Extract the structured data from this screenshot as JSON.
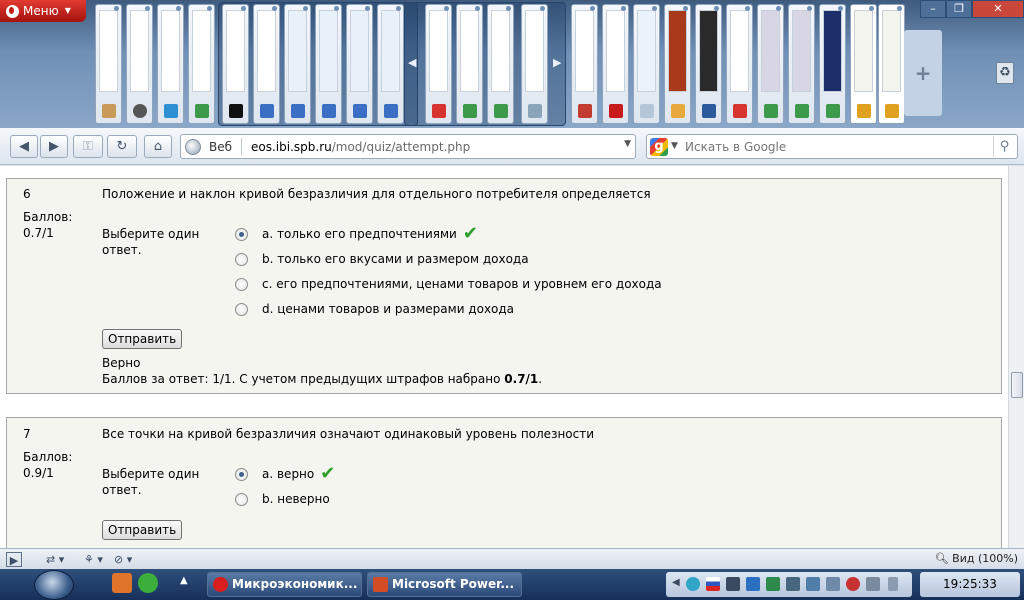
{
  "browser": {
    "menu_label": "Меню",
    "address": {
      "web_label": "Веб",
      "url_domain": "eos.ibi.spb.ru",
      "url_path": "/mod/quiz/attempt.php"
    },
    "search": {
      "placeholder": "Искать в Google"
    }
  },
  "quiz": {
    "questions": [
      {
        "number": "6",
        "text": "Положение и наклон кривой безразличия для отдельного потребителя определяется",
        "grade_label": "Баллов:",
        "grade_value": "0.7/1",
        "prompt": "Выберите один ответ.",
        "options": [
          {
            "label": "a. только его предпочтениями",
            "selected": true,
            "correct": true
          },
          {
            "label": "b. только его вкусами и размером дохода",
            "selected": false,
            "correct": false
          },
          {
            "label": "c. его предпочтениями, ценами товаров и уровнем его дохода",
            "selected": false,
            "correct": false
          },
          {
            "label": "d. ценами товаров и размерами дохода",
            "selected": false,
            "correct": false
          }
        ],
        "submit_label": "Отправить",
        "feedback_status": "Верно",
        "feedback_text": "Баллов за ответ: 1/1. С учетом предыдущих штрафов набрано ",
        "feedback_score": "0.7/1",
        "feedback_end": "."
      },
      {
        "number": "7",
        "text": "Все точки на кривой безразличия означают одинаковый уровень полезности",
        "grade_label": "Баллов:",
        "grade_value": "0.9/1",
        "prompt": "Выберите один ответ.",
        "options": [
          {
            "label": "a. верно",
            "selected": true,
            "correct": true
          },
          {
            "label": "b. неверно",
            "selected": false,
            "correct": false
          }
        ],
        "submit_label": "Отправить"
      }
    ]
  },
  "statusbar": {
    "zoom_label": "Вид (100%)"
  },
  "taskbar": {
    "tasks": [
      {
        "label": "Микроэкономик...",
        "color": "#d81e1e"
      },
      {
        "label": "Microsoft Power...",
        "color": "#d24d23"
      }
    ],
    "clock": "19:25:33"
  },
  "colors": {
    "checkmark": "#2aa02a",
    "opera_red": "#c51b14"
  }
}
